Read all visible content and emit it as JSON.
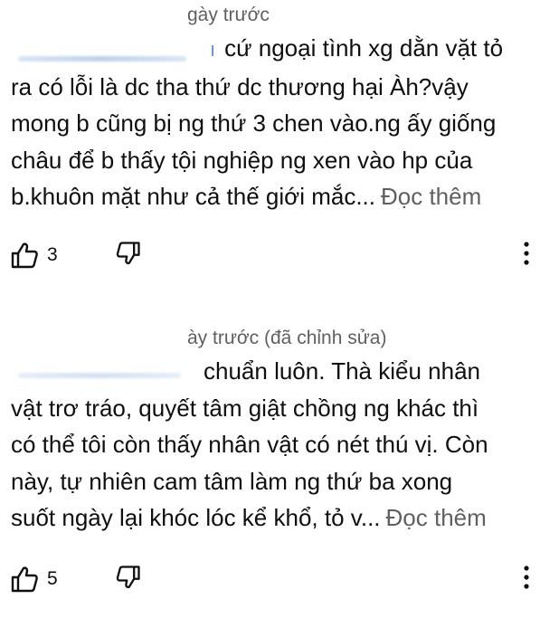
{
  "comments": [
    {
      "timestamp": "gày trước",
      "text_lines": [
        "cứ ngoại tình xg dằn vặt tỏ",
        "ra có lỗi là dc tha thứ dc thương hại Àh?vậy",
        "mong b cũng bị ng thứ 3 chen vào.ng ấy giống",
        "châu để b thấy tội nghiệp ng xen vào hp của",
        "b.khuôn mặt như cả thế giới mắc..."
      ],
      "read_more": "Đọc thêm",
      "like_count": "3",
      "author_partial": "ı"
    },
    {
      "timestamp": "ày trước (đã chỉnh sửa)",
      "text_lines": [
        "chuẩn luôn. Thà kiểu nhân",
        "vật trơ tráo, quyết tâm giật chồng ng khác thì",
        "có thể tôi còn thấy nhân vật có nét thú vị. Còn",
        "này, tự nhiên cam tâm làm ng thứ ba xong",
        "suốt ngày lại khóc lóc kể khổ, tỏ v..."
      ],
      "read_more": "Đọc thêm",
      "like_count": "5"
    }
  ],
  "icons": {
    "like": "thumbs-up-icon",
    "dislike": "thumbs-down-icon",
    "more": "more-vert-icon"
  },
  "colors": {
    "text": "#0f0f0f",
    "secondary": "#606060",
    "background": "#ffffff"
  }
}
